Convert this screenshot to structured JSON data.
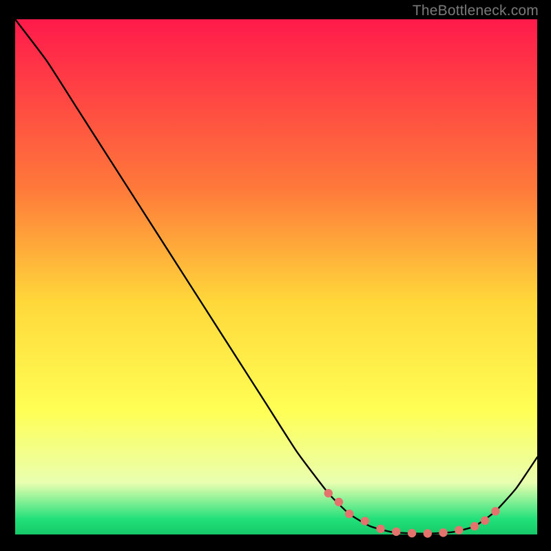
{
  "watermark": "TheBottleneck.com",
  "colors": {
    "gradient_top": "#ff1a4b",
    "gradient_mid1": "#ff7a3a",
    "gradient_mid2": "#ffd83a",
    "gradient_mid3": "#ffff55",
    "gradient_low": "#e9ffb0",
    "gradient_bottom": "#22e07a",
    "gradient_bottom2": "#16c968",
    "line": "#000000",
    "marker": "#e5736d",
    "bg": "#000000"
  },
  "chart_data": {
    "type": "line",
    "title": "",
    "xlabel": "",
    "ylabel": "",
    "xlim": [
      0,
      100
    ],
    "ylim": [
      0,
      100
    ],
    "series": [
      {
        "name": "curve",
        "x": [
          0,
          6,
          12,
          18,
          24,
          30,
          36,
          42,
          48,
          54,
          60,
          64,
          68,
          72,
          76,
          80,
          84,
          88,
          92,
          96,
          100
        ],
        "y": [
          100,
          92,
          82.5,
          73,
          63.5,
          54,
          44.5,
          35,
          25.5,
          16,
          8,
          4,
          1.6,
          0.5,
          0.2,
          0.2,
          0.5,
          1.6,
          4.5,
          9,
          15
        ]
      }
    ],
    "markers": {
      "name": "points",
      "x": [
        60,
        62,
        64,
        67,
        70,
        73,
        76,
        79,
        82,
        85,
        88,
        90,
        92
      ],
      "y": [
        8,
        6.3,
        4,
        2.6,
        1.1,
        0.55,
        0.25,
        0.2,
        0.35,
        0.85,
        1.6,
        2.7,
        4.5
      ]
    }
  }
}
